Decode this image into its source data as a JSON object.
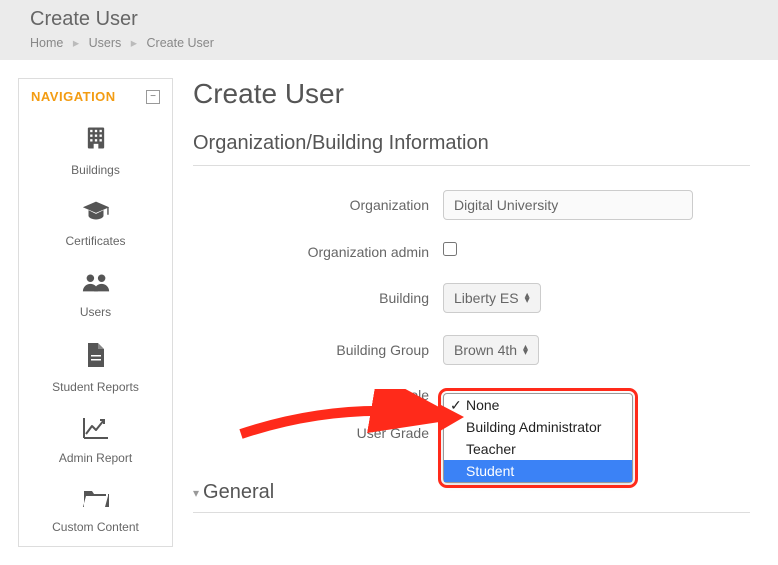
{
  "header": {
    "title": "Create User",
    "breadcrumb": {
      "home": "Home",
      "users": "Users",
      "current": "Create User"
    }
  },
  "sidebar": {
    "title": "NAVIGATION",
    "items": [
      {
        "label": "Buildings"
      },
      {
        "label": "Certificates"
      },
      {
        "label": "Users"
      },
      {
        "label": "Student Reports"
      },
      {
        "label": "Admin Report"
      },
      {
        "label": "Custom Content"
      }
    ]
  },
  "main": {
    "title": "Create User",
    "section": "Organization/Building Information",
    "labels": {
      "organization": "Organization",
      "org_admin": "Organization admin",
      "building": "Building",
      "building_group": "Building Group",
      "role": "Role",
      "user_grade": "User Grade"
    },
    "values": {
      "organization": "Digital University",
      "building": "Liberty ES",
      "building_group": "Brown 4th"
    },
    "role_options": [
      "None",
      "Building Administrator",
      "Teacher",
      "Student"
    ],
    "role_selected": "None",
    "role_highlighted": "Student",
    "general_section": "General"
  }
}
